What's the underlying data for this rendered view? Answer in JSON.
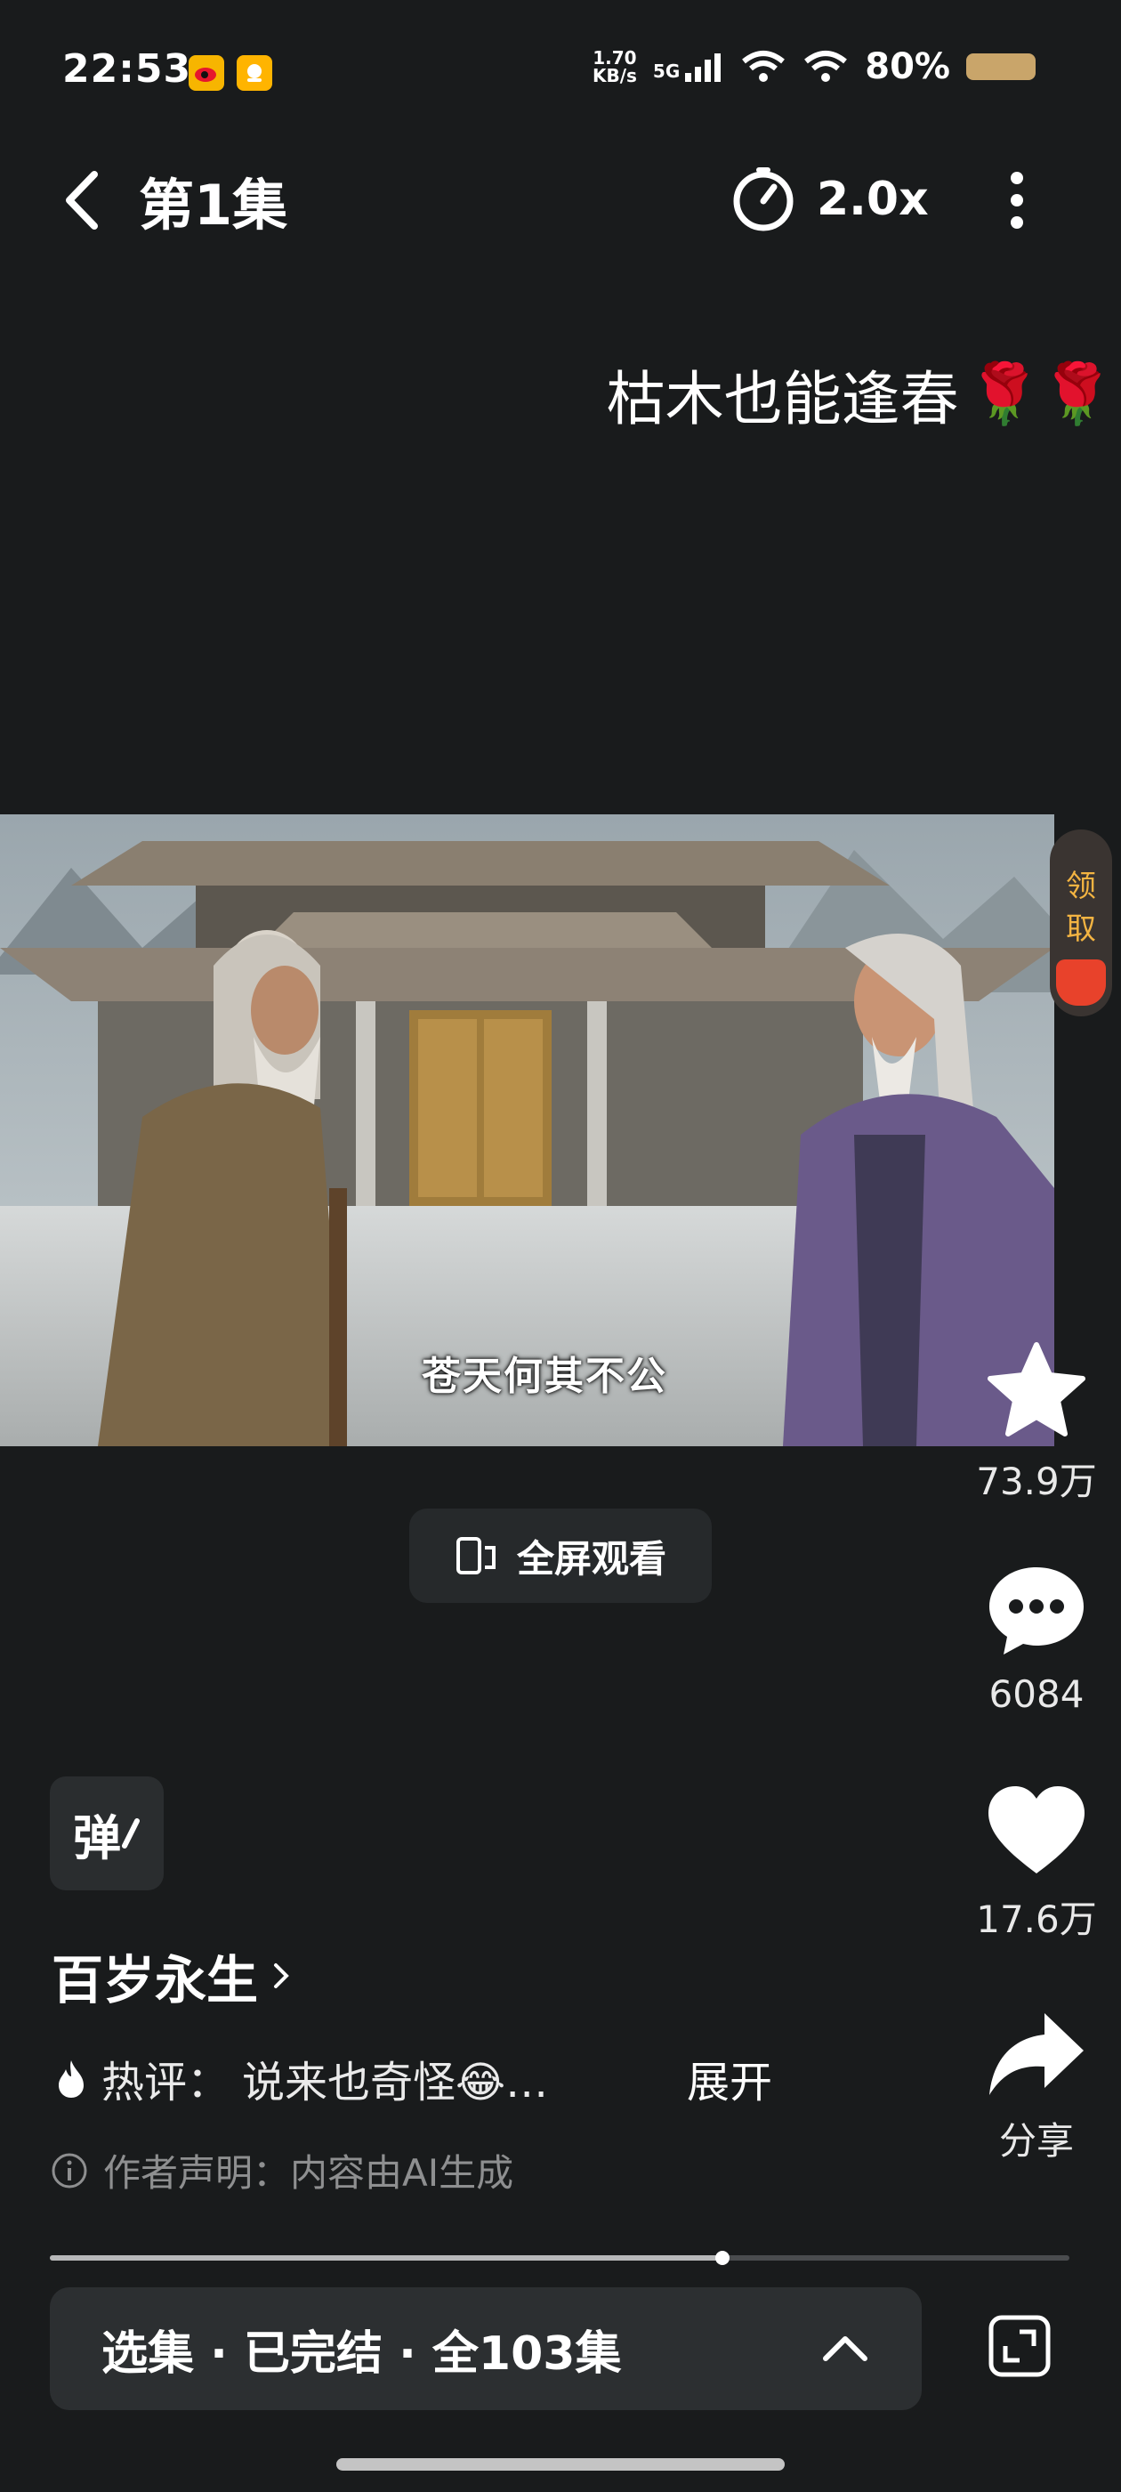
{
  "status_bar": {
    "time": "22:53",
    "apps": [
      "weibo-icon",
      "miniapp-icon"
    ],
    "net_speed_value": "1.70",
    "net_speed_unit": "KB/s",
    "network": "5G",
    "battery": "80%"
  },
  "header": {
    "episode_title": "第1集",
    "speed_label": "2.0x"
  },
  "caption": {
    "text": "枯木也能逢春",
    "emoji": "🌹🌹"
  },
  "video": {
    "subtitle": "苍天何其不公",
    "claim_label_1": "领",
    "claim_label_2": "取"
  },
  "fullscreen": {
    "label": "全屏观看"
  },
  "actions": {
    "favorite_count": "73.9万",
    "comment_count": "6084",
    "like_count": "17.6万",
    "share_label": "分享"
  },
  "info": {
    "danmaku_label": "弹",
    "show_title": "百岁永生",
    "hot_comment_prefix": "热评：",
    "hot_comment_text": "说来也奇怪😂…",
    "expand_label": "展开",
    "notice": "作者声明：内容由AI生成"
  },
  "progress": {
    "value": 0.66
  },
  "episode_bar": {
    "label": "选集 · 已完结 · 全103集"
  },
  "colors": {
    "background": "#191b1c",
    "accent": "#f3b442"
  }
}
